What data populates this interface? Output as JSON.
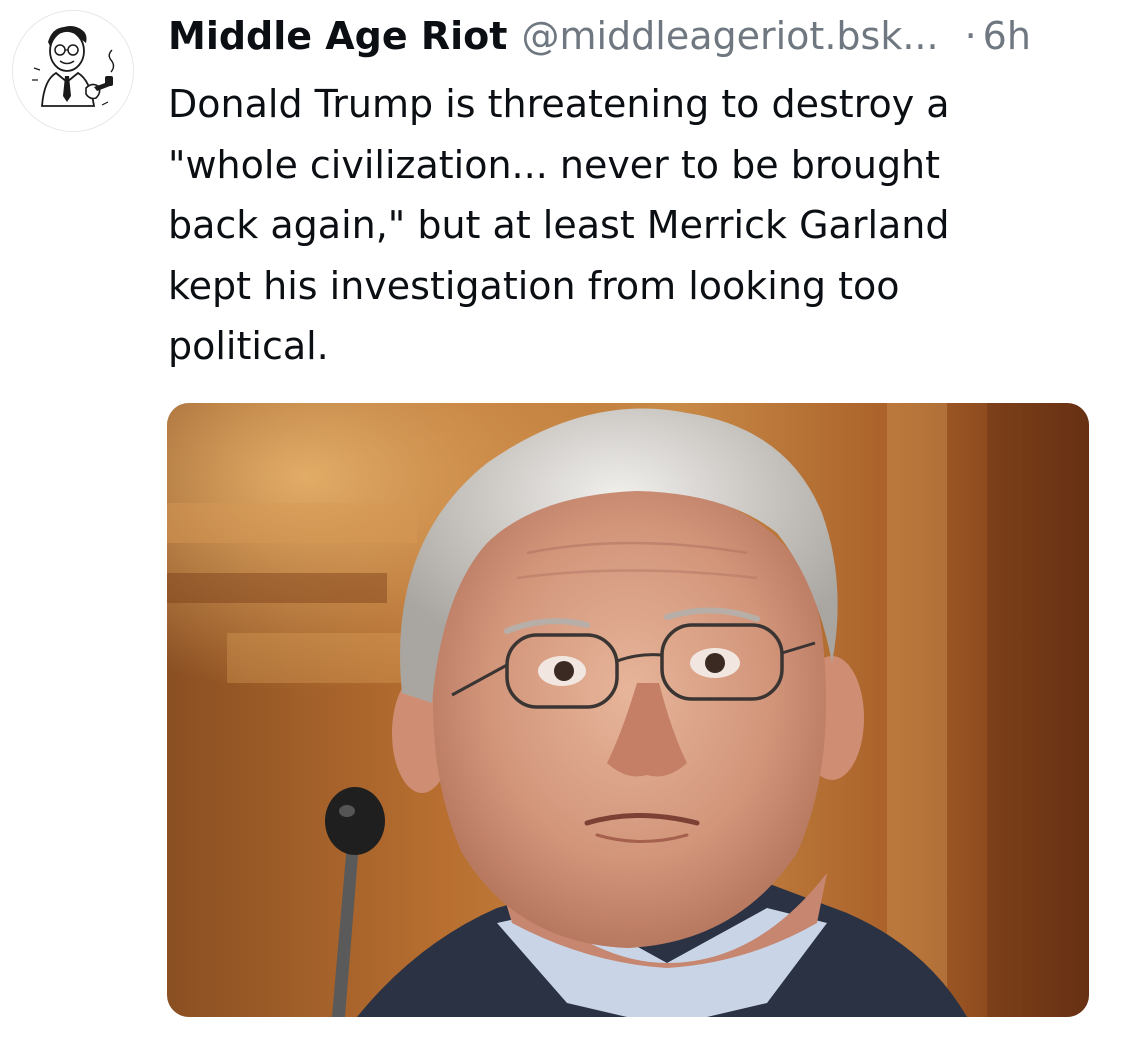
{
  "post": {
    "author": {
      "display_name": "Middle Age Riot",
      "handle": "@middleageriot.bsk...",
      "avatar_icon": "vintage-man-with-pipe-illustration"
    },
    "separator": "·",
    "timestamp": "6h",
    "text": "Donald Trump is threatening to destroy a\n\"whole civilization... never to be brought\nback again,\" but at least Merrick Garland\nkept his investigation from looking too\npolitical.",
    "image": {
      "subject": "photo-of-merrick-garland"
    }
  },
  "colors": {
    "text_primary": "#0b0f14",
    "text_secondary": "#6f7780",
    "background": "#ffffff"
  }
}
